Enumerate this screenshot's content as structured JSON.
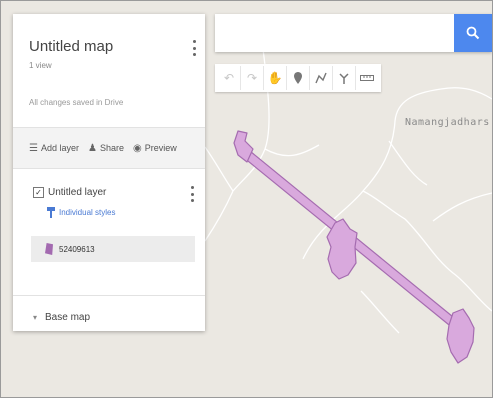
{
  "map": {
    "place_label": "Namangjadhars",
    "feature_color": "#d9a9dd",
    "feature_stroke": "#a56cb0"
  },
  "search": {
    "value": "",
    "placeholder": ""
  },
  "toolbar": {
    "tools": [
      "undo-icon",
      "redo-icon",
      "hand-icon",
      "marker-icon",
      "draw-line-icon",
      "directions-icon",
      "ruler-icon"
    ]
  },
  "panel": {
    "title": "Untitled map",
    "views": "1 view",
    "saved_status": "All changes saved in Drive",
    "actions": {
      "add_layer": "Add layer",
      "share": "Share",
      "preview": "Preview"
    },
    "layer": {
      "name": "Untitled layer",
      "checked": true,
      "styles_label": "Individual styles",
      "feature_name": "52409613"
    },
    "base_map": "Base map"
  }
}
